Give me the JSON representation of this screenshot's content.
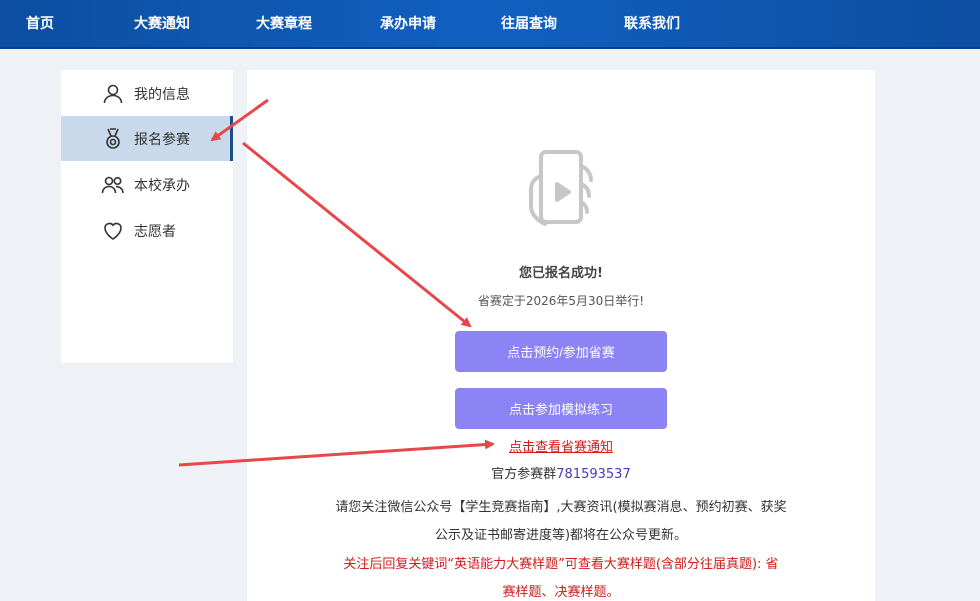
{
  "nav": {
    "items": [
      {
        "label": "首页"
      },
      {
        "label": "大赛通知"
      },
      {
        "label": "大赛章程"
      },
      {
        "label": "承办申请"
      },
      {
        "label": "往届查询"
      },
      {
        "label": "联系我们"
      }
    ]
  },
  "sidebar": {
    "items": [
      {
        "label": "我的信息",
        "icon": "user-icon"
      },
      {
        "label": "报名参赛",
        "icon": "medal-icon",
        "active": true
      },
      {
        "label": "本校承办",
        "icon": "users-icon"
      },
      {
        "label": "志愿者",
        "icon": "heart-icon"
      }
    ]
  },
  "main": {
    "success_title": "您已报名成功!",
    "date_note": "省赛定于2026年5月30日举行!",
    "btn_reserve": "点击预约/参加省赛",
    "btn_practice": "点击参加模拟练习",
    "notice_link": "点击查看省赛通知",
    "group_label": "官方参赛群",
    "group_number": "781593537",
    "para1_line1": "请您关注微信公众号【学生竞赛指南】,大赛资讯(模拟赛消息、预约初赛、获奖",
    "para1_line2": "公示及证书邮寄进度等)都将在公众号更新。",
    "para2_line1": "关注后回复关键词“英语能力大赛样题”可查看大赛样题(含部分往届真题): 省",
    "para2_line2": "赛样题、决赛样题。"
  },
  "colors": {
    "nav_bg": "#1160c0",
    "button": "#8c84f5",
    "link_red": "#d11b1b",
    "active_item": "#c7d9ea",
    "annotation_arrow": "#e8474a"
  }
}
